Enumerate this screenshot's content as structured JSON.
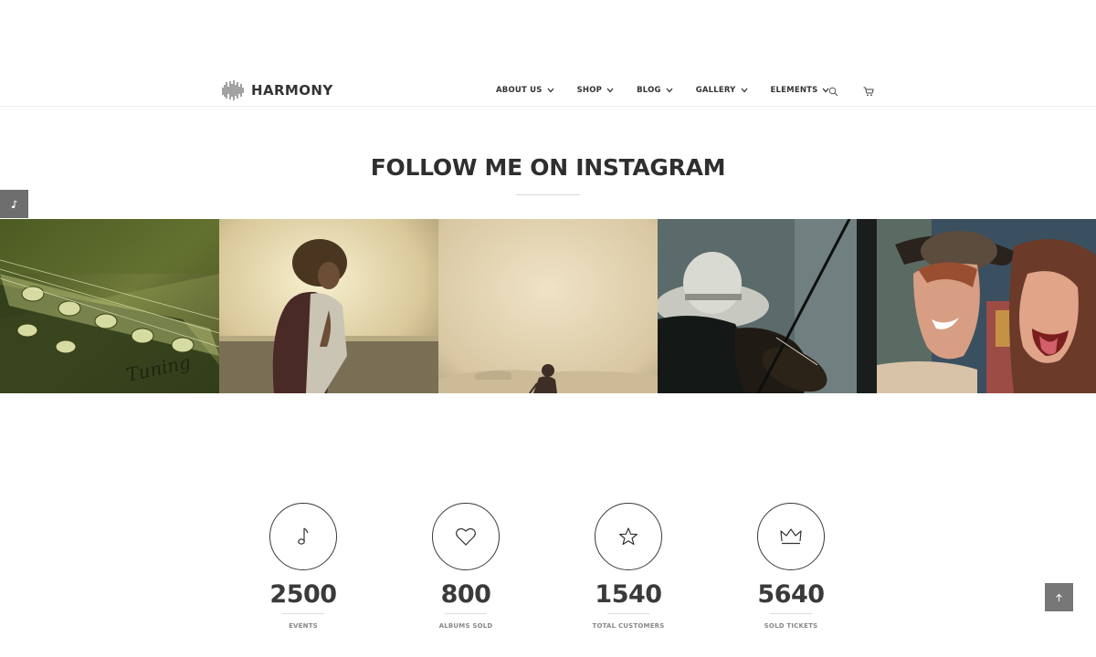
{
  "brand": {
    "name": "HARMONY",
    "logo_icon": "soundwave-logo-icon"
  },
  "nav": {
    "items": [
      {
        "label": "ABOUT US",
        "icon": "chevron-down-icon"
      },
      {
        "label": "SHOP",
        "icon": "chevron-down-icon"
      },
      {
        "label": "BLOG",
        "icon": "chevron-down-icon"
      },
      {
        "label": "GALLERY",
        "icon": "chevron-down-icon"
      },
      {
        "label": "ELEMENTS",
        "icon": "chevron-down-icon"
      }
    ],
    "search_icon": "search-icon",
    "cart_icon": "cart-icon"
  },
  "section": {
    "title": "FOLLOW ME ON INSTAGRAM"
  },
  "side_tab_icon": "music-note-icon",
  "instagram": {
    "photos": [
      {
        "subject": "guitar headstock tuning pegs"
      },
      {
        "subject": "curly-haired man with backpack by the sea"
      },
      {
        "subject": "silhouette of person on hazy beach"
      },
      {
        "subject": "violinist in wide-brim hat"
      },
      {
        "subject": "two laughing women at festival"
      }
    ]
  },
  "counters": [
    {
      "value": "2500",
      "label": "EVENTS",
      "icon": "music-note-icon"
    },
    {
      "value": "800",
      "label": "ALBUMS SOLD",
      "icon": "heart-icon"
    },
    {
      "value": "1540",
      "label": "TOTAL CUSTOMERS",
      "icon": "star-icon"
    },
    {
      "value": "5640",
      "label": "SOLD TICKETS",
      "icon": "crown-icon"
    }
  ],
  "back_to_top_icon": "arrow-up-icon",
  "colors": {
    "text_dark": "#333333",
    "divider": "#dddddd",
    "tab_gray": "#6e6e6e"
  }
}
